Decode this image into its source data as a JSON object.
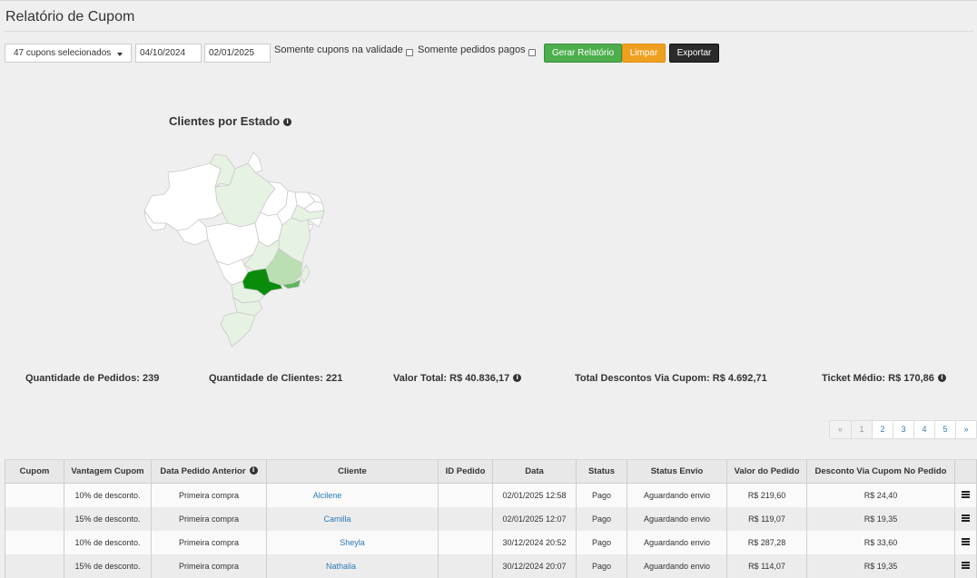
{
  "page": {
    "title": "Relatório de Cupom"
  },
  "filters": {
    "coupon_select": "47 cupons selecionados",
    "date_start": "04/10/2024",
    "date_end": "02/01/2025",
    "only_valid_label": "Somente cupons na validade",
    "only_paid_label": "Somente pedidos pagos",
    "generate_label": "Gerar Relatório",
    "clear_label": "Limpar",
    "export_label": "Exportar"
  },
  "map": {
    "title": "Clientes por Estado",
    "colors": {
      "none": "#ffffff",
      "low": "#e6f3e3",
      "mid": "#b9dfb3",
      "high": "#5db35b",
      "max": "#0a8c0a"
    }
  },
  "stats": {
    "orders": "Quantidade de Pedidos: 239",
    "clients": "Quantidade de Clientes: 221",
    "total_value": "Valor Total: R$ 40.836,17",
    "total_discount": "Total Descontos Via Cupom: R$ 4.692,71",
    "avg_ticket": "Ticket Médio: R$ 170,86"
  },
  "pagination": {
    "prev": "«",
    "pages": [
      "1",
      "2",
      "3",
      "4",
      "5"
    ],
    "next": "»",
    "current": "1"
  },
  "table": {
    "headers": {
      "coupon": "Cupom",
      "benefit": "Vantagem Cupom",
      "prev_order_date": "Data Pedido Anterior",
      "client": "Cliente",
      "order_id": "ID Pedido",
      "date": "Data",
      "status": "Status",
      "shipping_status": "Status Envio",
      "order_value": "Valor do Pedido",
      "discount": "Desconto Via Cupom No Pedido"
    },
    "rows": [
      {
        "coupon": "",
        "benefit": "10% de desconto.",
        "prev": "Primeira compra",
        "client": "Alcilene",
        "order_id": "",
        "date": "02/01/2025 12:58",
        "status": "Pago",
        "shipping": "Aguardando envio",
        "value": "R$ 219,60",
        "discount": "R$ 24,40"
      },
      {
        "coupon": "",
        "benefit": "15% de desconto.",
        "prev": "Primeira compra",
        "client": "Camilla",
        "order_id": "",
        "date": "02/01/2025 12:07",
        "status": "Pago",
        "shipping": "Aguardando envio",
        "value": "R$ 119,07",
        "discount": "R$ 19,35"
      },
      {
        "coupon": "",
        "benefit": "10% de desconto.",
        "prev": "Primeira compra",
        "client": "Sheyla",
        "order_id": "",
        "date": "30/12/2024 20:52",
        "status": "Pago",
        "shipping": "Aguardando envio",
        "value": "R$ 287,28",
        "discount": "R$ 33,60"
      },
      {
        "coupon": "",
        "benefit": "15% de desconto.",
        "prev": "Primeira compra",
        "client": "Nathalia",
        "order_id": "",
        "date": "30/12/2024 20:07",
        "status": "Pago",
        "shipping": "Aguardando envio",
        "value": "R$ 114,07",
        "discount": "R$ 19,35"
      }
    ]
  }
}
